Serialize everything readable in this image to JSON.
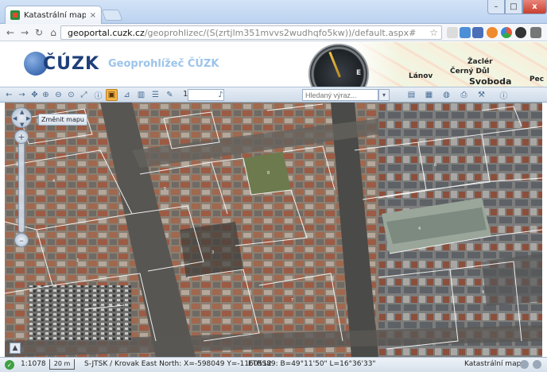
{
  "browser": {
    "tab_title": "Katastrální mapa",
    "tab_close": "×",
    "address_host": "geoportal.cuzk.cz",
    "address_path": "/geoprohlizec/(S(zrtjlm351mvvs2wudhqfo5kw))/default.aspx#",
    "window_min": "–",
    "window_max": "□",
    "window_close": "x"
  },
  "header": {
    "logo_text": "ČÚZK",
    "app_title": "Geoprohlížeč ČÚZK",
    "places": [
      "Žaclér",
      "Lánov",
      "Černý Důl",
      "Svoboda",
      "Pec"
    ],
    "compass_label": "E"
  },
  "toolbar": {
    "scale_prefix": "1:",
    "search_placeholder": "Hledaný výraz..."
  },
  "map": {
    "change_map_label": "Změnit mapu",
    "zoom_in": "+",
    "zoom_out": "–"
  },
  "status": {
    "scale": "1:1078",
    "scalebar": "20 m",
    "coordinates": "S-JTSK / Krovak East North: X=-598049 Y=-1160512",
    "etrs": "ETRS89: B=49°11'50\" L=16°36'33\"",
    "layer_name": "Katastrální mapa"
  },
  "colors": {
    "accent": "#f3b64a",
    "title_blue": "#9cc4ea",
    "logo_blue": "#1e3f7a"
  }
}
